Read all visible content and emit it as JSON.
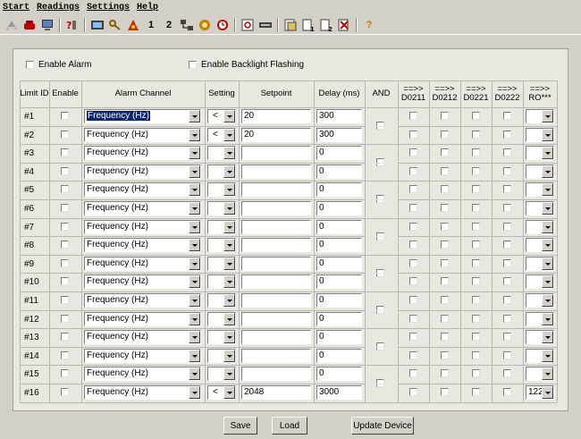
{
  "menu": [
    "Start",
    "Readings",
    "Settings",
    "Help"
  ],
  "toolbar_icons": [
    "exit-icon",
    "phone-icon",
    "monitor-icon",
    "help-cursor-icon",
    "meter-icon",
    "key-icon",
    "alarm-icon",
    "one-icon",
    "two-icon",
    "network-icon",
    "settings-icon",
    "clock-icon",
    "refresh-icon",
    "device-icon",
    "data-icon",
    "doc1-icon",
    "doc2-icon",
    "erase-icon",
    "question-icon"
  ],
  "toolbar_text": {
    "one": "1",
    "two": "2",
    "question": "?"
  },
  "options": {
    "enable_alarm": "Enable Alarm",
    "enable_backlight": "Enable Backlight Flashing"
  },
  "headers": {
    "limit_id": "Limit ID",
    "enable": "Enable",
    "alarm_channel": "Alarm Channel",
    "setting": "Setting",
    "setpoint": "Setpoint",
    "delay": "Delay (ms)",
    "and": "AND",
    "d0211": "==>> D0211",
    "d0212": "==>> D0212",
    "d0221": "==>> D0221",
    "d0222": "==>> D0222",
    "ro": "==>> RO***"
  },
  "rows": [
    {
      "id": "#1",
      "channel": "Frequency (Hz)",
      "setting": "<",
      "setpoint": "20",
      "delay": "300",
      "ro": ""
    },
    {
      "id": "#2",
      "channel": "Frequency (Hz)",
      "setting": "<",
      "setpoint": "20",
      "delay": "300",
      "ro": ""
    },
    {
      "id": "#3",
      "channel": "Frequency (Hz)",
      "setting": "",
      "setpoint": "",
      "delay": "0",
      "ro": ""
    },
    {
      "id": "#4",
      "channel": "Frequency (Hz)",
      "setting": "",
      "setpoint": "",
      "delay": "0",
      "ro": ""
    },
    {
      "id": "#5",
      "channel": "Frequency (Hz)",
      "setting": "",
      "setpoint": "",
      "delay": "0",
      "ro": ""
    },
    {
      "id": "#6",
      "channel": "Frequency (Hz)",
      "setting": "",
      "setpoint": "",
      "delay": "0",
      "ro": ""
    },
    {
      "id": "#7",
      "channel": "Frequency (Hz)",
      "setting": "",
      "setpoint": "",
      "delay": "0",
      "ro": ""
    },
    {
      "id": "#8",
      "channel": "Frequency (Hz)",
      "setting": "",
      "setpoint": "",
      "delay": "0",
      "ro": ""
    },
    {
      "id": "#9",
      "channel": "Frequency (Hz)",
      "setting": "",
      "setpoint": "",
      "delay": "0",
      "ro": ""
    },
    {
      "id": "#10",
      "channel": "Frequency (Hz)",
      "setting": "",
      "setpoint": "",
      "delay": "0",
      "ro": ""
    },
    {
      "id": "#11",
      "channel": "Frequency (Hz)",
      "setting": "",
      "setpoint": "",
      "delay": "0",
      "ro": ""
    },
    {
      "id": "#12",
      "channel": "Frequency (Hz)",
      "setting": "",
      "setpoint": "",
      "delay": "0",
      "ro": ""
    },
    {
      "id": "#13",
      "channel": "Frequency (Hz)",
      "setting": "",
      "setpoint": "",
      "delay": "0",
      "ro": ""
    },
    {
      "id": "#14",
      "channel": "Frequency (Hz)",
      "setting": "",
      "setpoint": "",
      "delay": "0",
      "ro": ""
    },
    {
      "id": "#15",
      "channel": "Frequency (Hz)",
      "setting": "",
      "setpoint": "",
      "delay": "0",
      "ro": ""
    },
    {
      "id": "#16",
      "channel": "Frequency (Hz)",
      "setting": "<",
      "setpoint": "2048",
      "delay": "3000",
      "ro": "122"
    }
  ],
  "buttons": {
    "save": "Save",
    "load": "Load",
    "update": "Update Device"
  },
  "colors": {
    "selection": "#0a246a",
    "window_bg": "#d4d0c8",
    "panel_bg": "#e8e8e0"
  }
}
